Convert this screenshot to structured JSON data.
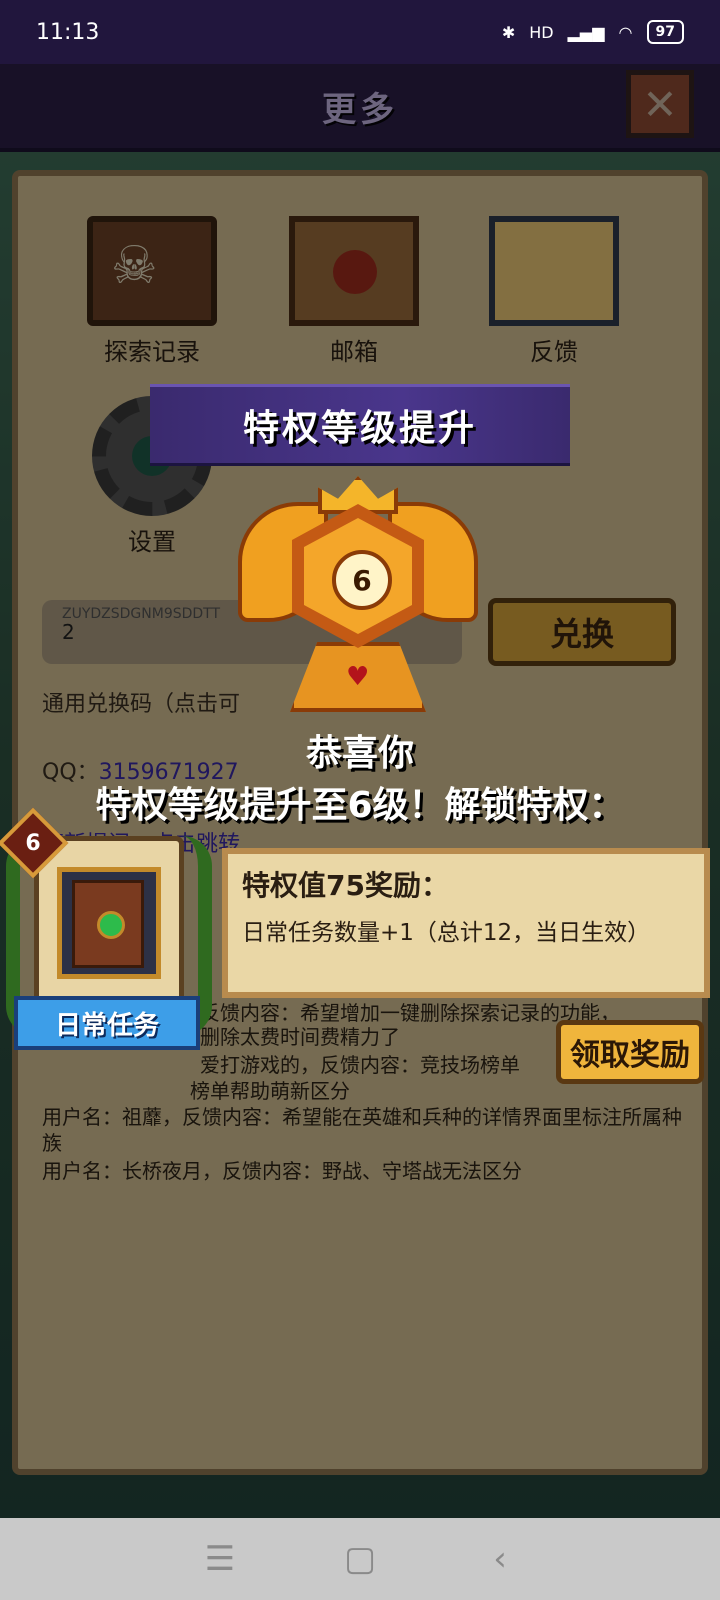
{
  "status_bar": {
    "time": "11:13",
    "battery": "97",
    "signal_label": "HD"
  },
  "header": {
    "title": "更多",
    "close_icon": "close-icon"
  },
  "menu": {
    "items": [
      {
        "label": "探索记录",
        "icon": "skull-book-icon"
      },
      {
        "label": "邮箱",
        "icon": "mail-icon"
      },
      {
        "label": "反馈",
        "icon": "scroll-icon"
      },
      {
        "label": "设置",
        "icon": "gear-icon"
      }
    ]
  },
  "redeem": {
    "code_partial": "ZUYDZSDGNM9SDDTT",
    "code_value": "2",
    "exchange_label": "兑换",
    "common_code_label": "通用兑换码（点击可"
  },
  "contact": {
    "qq_label": "QQ：",
    "qq_value": "3159671927",
    "link_text": "萌新提问，点击跳转"
  },
  "feedback": {
    "line1": "反馈内容：希望增加一键删除探索记录的功能，",
    "line2": "删除太费时间费精力了",
    "line3": "爱打游戏的，反馈内容：竞技场榜单",
    "line4": "榜单帮助萌新区分",
    "line5": "用户名：祖蘼，反馈内容：希望能在英雄和兵种的详情界面里标注所属种族",
    "line6": "用户名：长桥夜月，反馈内容：野战、守塔战无法区分"
  },
  "modal": {
    "banner_title": "特权等级提升",
    "level": "6",
    "congrats": "恭喜你",
    "unlock_text": "特权等级提升至6级！解锁特权：",
    "card_level": "6",
    "card_ribbon": "日常任务",
    "reward_title": "特权值75奖励：",
    "reward_desc": "日常任务数量+1（总计12，当日生效）",
    "claim_label": "领取奖励"
  },
  "navbar": {
    "menu": "☰",
    "home": "▢",
    "back": "‹"
  },
  "colors": {
    "banner": "#3a2a6e",
    "gold": "#f0b53c",
    "parchment": "#d2bf92"
  }
}
